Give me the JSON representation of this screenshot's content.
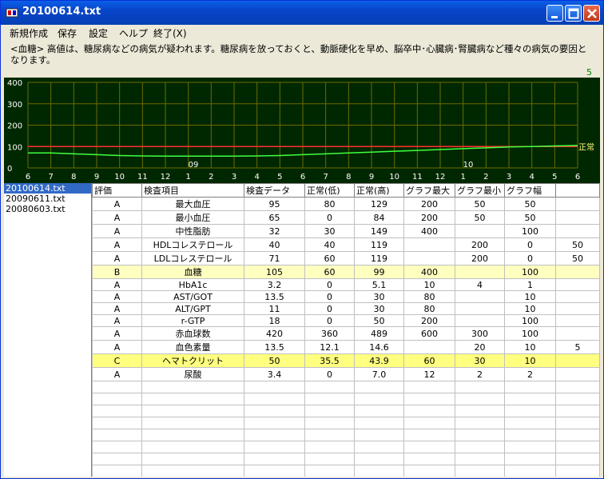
{
  "window": {
    "title": "20100614.txt"
  },
  "menu": {
    "items": [
      "新規作成",
      "保存",
      "設定",
      "ヘルプ",
      "終了(X)"
    ]
  },
  "description": {
    "text": "<血糖>  高値は、糖尿病などの病気が疑われます。糖尿病を放っておくと、動脈硬化を早め、脳卒中･心臓病･腎臓病など種々の病気の要因となります。",
    "page": "5"
  },
  "chart_data": {
    "type": "line",
    "ylim": [
      0,
      400
    ],
    "yticks": [
      "400",
      "300",
      "200",
      "100",
      "0"
    ],
    "xticks": [
      "6",
      "7",
      "8",
      "9",
      "10",
      "11",
      "12",
      "1",
      "2",
      "3",
      "4",
      "5",
      "6",
      "7",
      "8",
      "9",
      "10",
      "11",
      "12",
      "1",
      "2",
      "3",
      "4",
      "5",
      "6"
    ],
    "year_labels": [
      "09",
      "10"
    ],
    "normal_label": "正常",
    "series": [
      {
        "color": "#ff3030",
        "values": [
          100,
          100
        ]
      },
      {
        "color": "#40ff40",
        "values": [
          70,
          70,
          66,
          62,
          58,
          56,
          55,
          55,
          55,
          55,
          56,
          58,
          62,
          66,
          70,
          74,
          78,
          82,
          86,
          90,
          94,
          98,
          100,
          103,
          105
        ]
      }
    ],
    "colors": {
      "background": "#002800",
      "grid": "#6b6b00",
      "axis_text": "#ffffff",
      "normal_text": "#ffff80"
    }
  },
  "files": [
    "20100614.txt",
    "20090611.txt",
    "20080603.txt"
  ],
  "table": {
    "headers": [
      "評価",
      "検査項目",
      "検査データ",
      "正常(低)",
      "正常(高)",
      "グラフ最大",
      "グラフ最小",
      "グラフ幅",
      ""
    ],
    "rows": [
      [
        "A",
        "最大血圧",
        "95",
        "80",
        "129",
        "200",
        "50",
        "50",
        ""
      ],
      [
        "A",
        "最小血圧",
        "65",
        "0",
        "84",
        "200",
        "50",
        "50",
        ""
      ],
      [
        "A",
        "中性脂肪",
        "32",
        "30",
        "149",
        "400",
        "",
        "100",
        ""
      ],
      [
        "A",
        "HDLコレステロール",
        "40",
        "40",
        "119",
        "",
        "200",
        "0",
        "50"
      ],
      [
        "A",
        "LDLコレステロール",
        "71",
        "60",
        "119",
        "",
        "200",
        "0",
        "50"
      ],
      [
        "B",
        "血糖",
        "105",
        "60",
        "99",
        "400",
        "",
        "100",
        ""
      ],
      [
        "A",
        "HbA1c",
        "3.2",
        "0",
        "5.1",
        "10",
        "4",
        "1",
        ""
      ],
      [
        "A",
        "AST/GOT",
        "13.5",
        "0",
        "30",
        "80",
        "",
        "10",
        ""
      ],
      [
        "A",
        "ALT/GPT",
        "11",
        "0",
        "30",
        "80",
        "",
        "10",
        ""
      ],
      [
        "A",
        "r-GTP",
        "18",
        "0",
        "50",
        "200",
        "",
        "100",
        ""
      ],
      [
        "A",
        "赤血球数",
        "420",
        "360",
        "489",
        "600",
        "300",
        "100",
        ""
      ],
      [
        "A",
        "血色素量",
        "13.5",
        "12.1",
        "14.6",
        "",
        "20",
        "10",
        "5"
      ],
      [
        "C",
        "ヘマトクリット",
        "50",
        "35.5",
        "43.9",
        "60",
        "30",
        "10",
        ""
      ],
      [
        "A",
        "尿酸",
        "3.4",
        "0",
        "7.0",
        "12",
        "2",
        "2",
        ""
      ]
    ],
    "highlight": {
      "5": "light",
      "12": "bright"
    }
  }
}
